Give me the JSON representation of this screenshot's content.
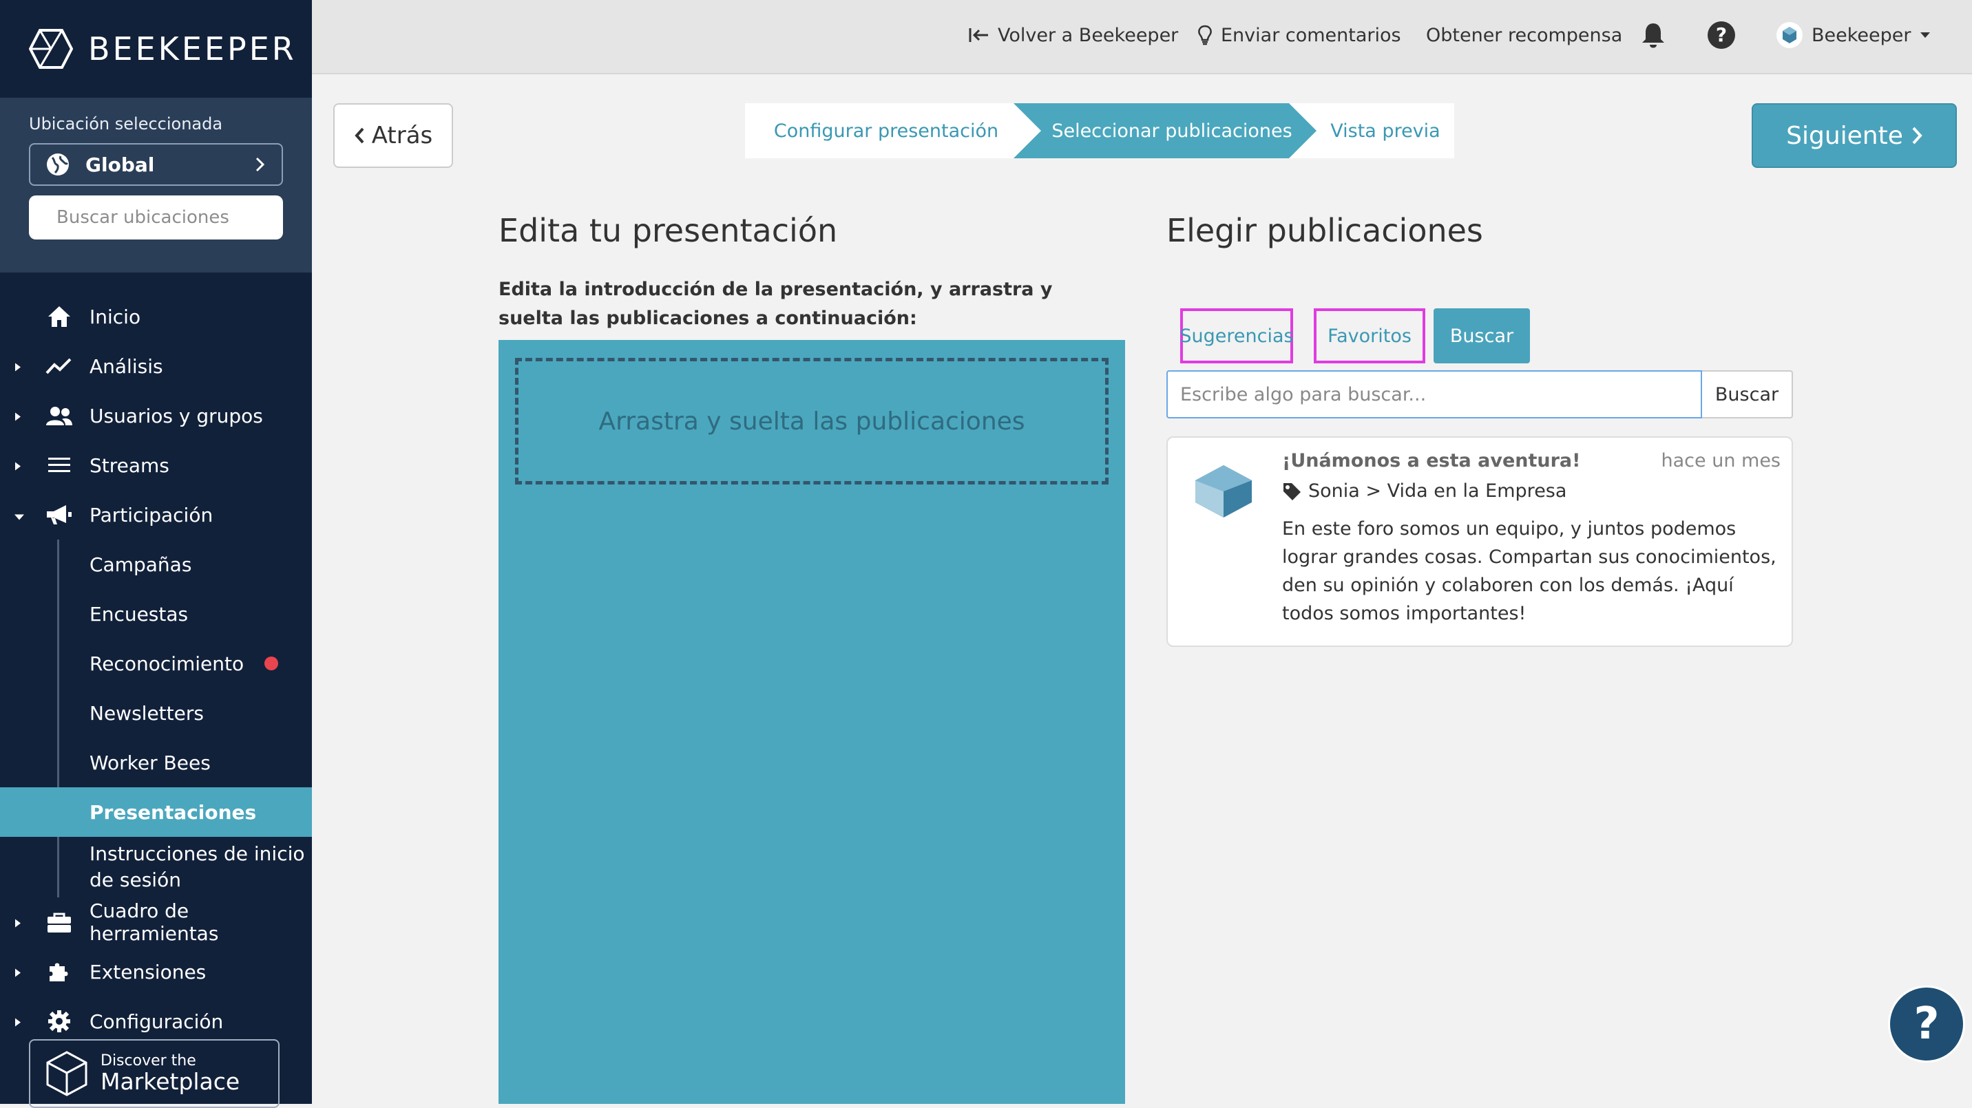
{
  "sidebar": {
    "brand": "BEEKEEPER",
    "location_label": "Ubicación seleccionada",
    "location_value": "Global",
    "location_search_placeholder": "Buscar ubicaciones",
    "nav": {
      "inicio": "Inicio",
      "analisis": "Análisis",
      "usuarios": "Usuarios y grupos",
      "streams": "Streams",
      "participacion": "Participación",
      "campanas": "Campañas",
      "encuestas": "Encuestas",
      "reconocimiento": "Reconocimiento",
      "newsletters": "Newsletters",
      "workerbees": "Worker Bees",
      "presentaciones": "Presentaciones",
      "instrucciones": "Instrucciones de inicio de sesión",
      "herramientas": "Cuadro de herramientas",
      "extensiones": "Extensiones",
      "configuracion": "Configuración"
    },
    "marketplace_small": "Discover the",
    "marketplace_big": "Marketplace"
  },
  "topbar": {
    "back_to": "Volver a Beekeeper",
    "feedback": "Enviar comentarios",
    "reward": "Obtener recompensa",
    "user": "Beekeeper"
  },
  "wizard": {
    "back": "Atrás",
    "next": "Siguiente",
    "steps": [
      "Configurar presentación",
      "Seleccionar publicaciones",
      "Vista previa"
    ]
  },
  "left": {
    "title": "Edita tu presentación",
    "subtitle": "Edita la introducción de la presentación, y arrastra y suelta las publicaciones a continuación:",
    "drop_text": "Arrastra y suelta las publicaciones"
  },
  "right": {
    "title": "Elegir publicaciones",
    "tabs": [
      "Sugerencias",
      "Favoritos",
      "Buscar"
    ],
    "search_placeholder": "Escribe algo para buscar...",
    "search_button": "Buscar",
    "post": {
      "title": "¡Unámonos a esta aventura!",
      "time": "hace un mes",
      "meta": "Sonia > Vida en la Empresa",
      "body": "En este foro somos un equipo, y juntos podemos lograr grandes cosas. Compartan sus conocimientos, den su opinión y colaboren con los demás. ¡Aquí todos somos importantes!"
    }
  },
  "help": "?"
}
